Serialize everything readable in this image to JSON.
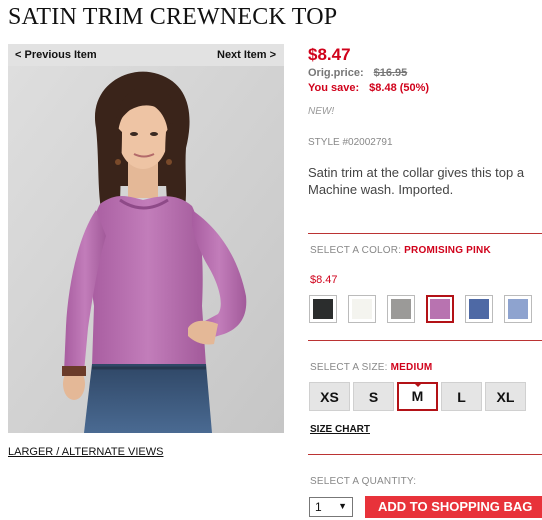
{
  "product": {
    "title": "SATIN TRIM CREWNECK TOP",
    "price": "$8.47",
    "orig_label": "Orig.price:",
    "orig_price": "$16.95",
    "save_label": "You save:",
    "save_amount": "$8.48 (50%)",
    "new_badge": "NEW!",
    "style": "STYLE #02002791",
    "description_line1": "Satin trim at the collar gives this top a",
    "description_line2": "Machine wash. Imported."
  },
  "nav": {
    "prev": "< Previous Item",
    "next": "Next Item >"
  },
  "image": {
    "alt_views_link": "LARGER / ALTERNATE VIEWS"
  },
  "color": {
    "label": "SELECT A COLOR:",
    "selected": "PROMISING PINK",
    "price": "$8.47",
    "swatches": [
      {
        "hex": "#2b2d2d"
      },
      {
        "hex": "#f4f4ef"
      },
      {
        "hex": "#9b9a98"
      },
      {
        "hex": "#b873b0",
        "selected": true
      },
      {
        "hex": "#4e69a5"
      },
      {
        "hex": "#8ea3cf"
      }
    ]
  },
  "size": {
    "label": "SELECT A SIZE:",
    "selected": "MEDIUM",
    "options": [
      "XS",
      "S",
      "M",
      "L",
      "XL"
    ],
    "selected_option": "M",
    "chart_link": "SIZE CHART"
  },
  "quantity": {
    "label": "SELECT A QUANTITY:",
    "value": "1"
  },
  "cart": {
    "add_button": "ADD TO SHOPPING BAG"
  },
  "colors": {
    "accent": "#d0021b",
    "button": "#e8323a"
  }
}
